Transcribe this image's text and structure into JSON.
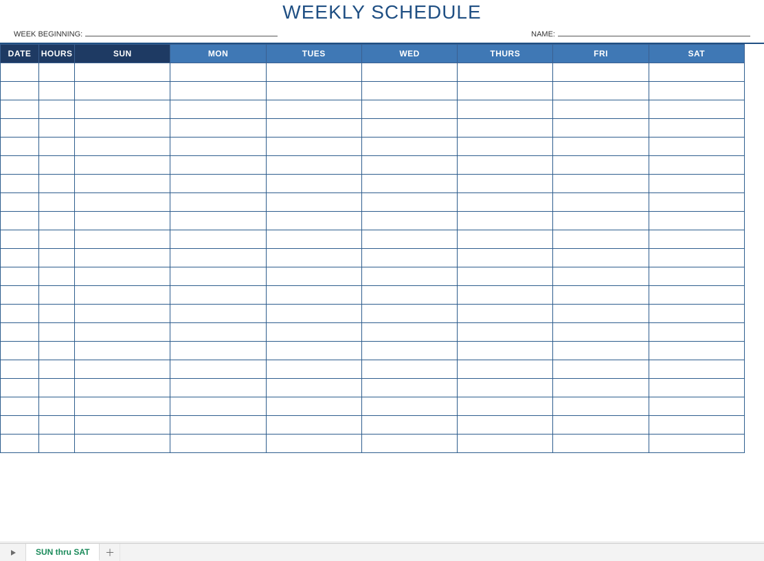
{
  "title": "WEEKLY SCHEDULE",
  "meta": {
    "week_label": "WEEK BEGINNING:",
    "week_value": "",
    "name_label": "NAME:",
    "name_value": ""
  },
  "columns": [
    {
      "key": "date",
      "label": "DATE",
      "style": "hdr-dark",
      "cls": "col-date"
    },
    {
      "key": "hours",
      "label": "HOURS",
      "style": "hdr-dark",
      "cls": "col-hours"
    },
    {
      "key": "sun",
      "label": "SUN",
      "style": "hdr-dark",
      "cls": "col-day"
    },
    {
      "key": "mon",
      "label": "MON",
      "style": "hdr-light",
      "cls": "col-day"
    },
    {
      "key": "tues",
      "label": "TUES",
      "style": "hdr-light",
      "cls": "col-day"
    },
    {
      "key": "wed",
      "label": "WED",
      "style": "hdr-light",
      "cls": "col-day"
    },
    {
      "key": "thurs",
      "label": "THURS",
      "style": "hdr-light",
      "cls": "col-day"
    },
    {
      "key": "fri",
      "label": "FRI",
      "style": "hdr-light",
      "cls": "col-day"
    },
    {
      "key": "sat",
      "label": "SAT",
      "style": "hdr-light",
      "cls": "col-day"
    }
  ],
  "row_count": 21,
  "tabs": {
    "active": "SUN thru SAT"
  }
}
